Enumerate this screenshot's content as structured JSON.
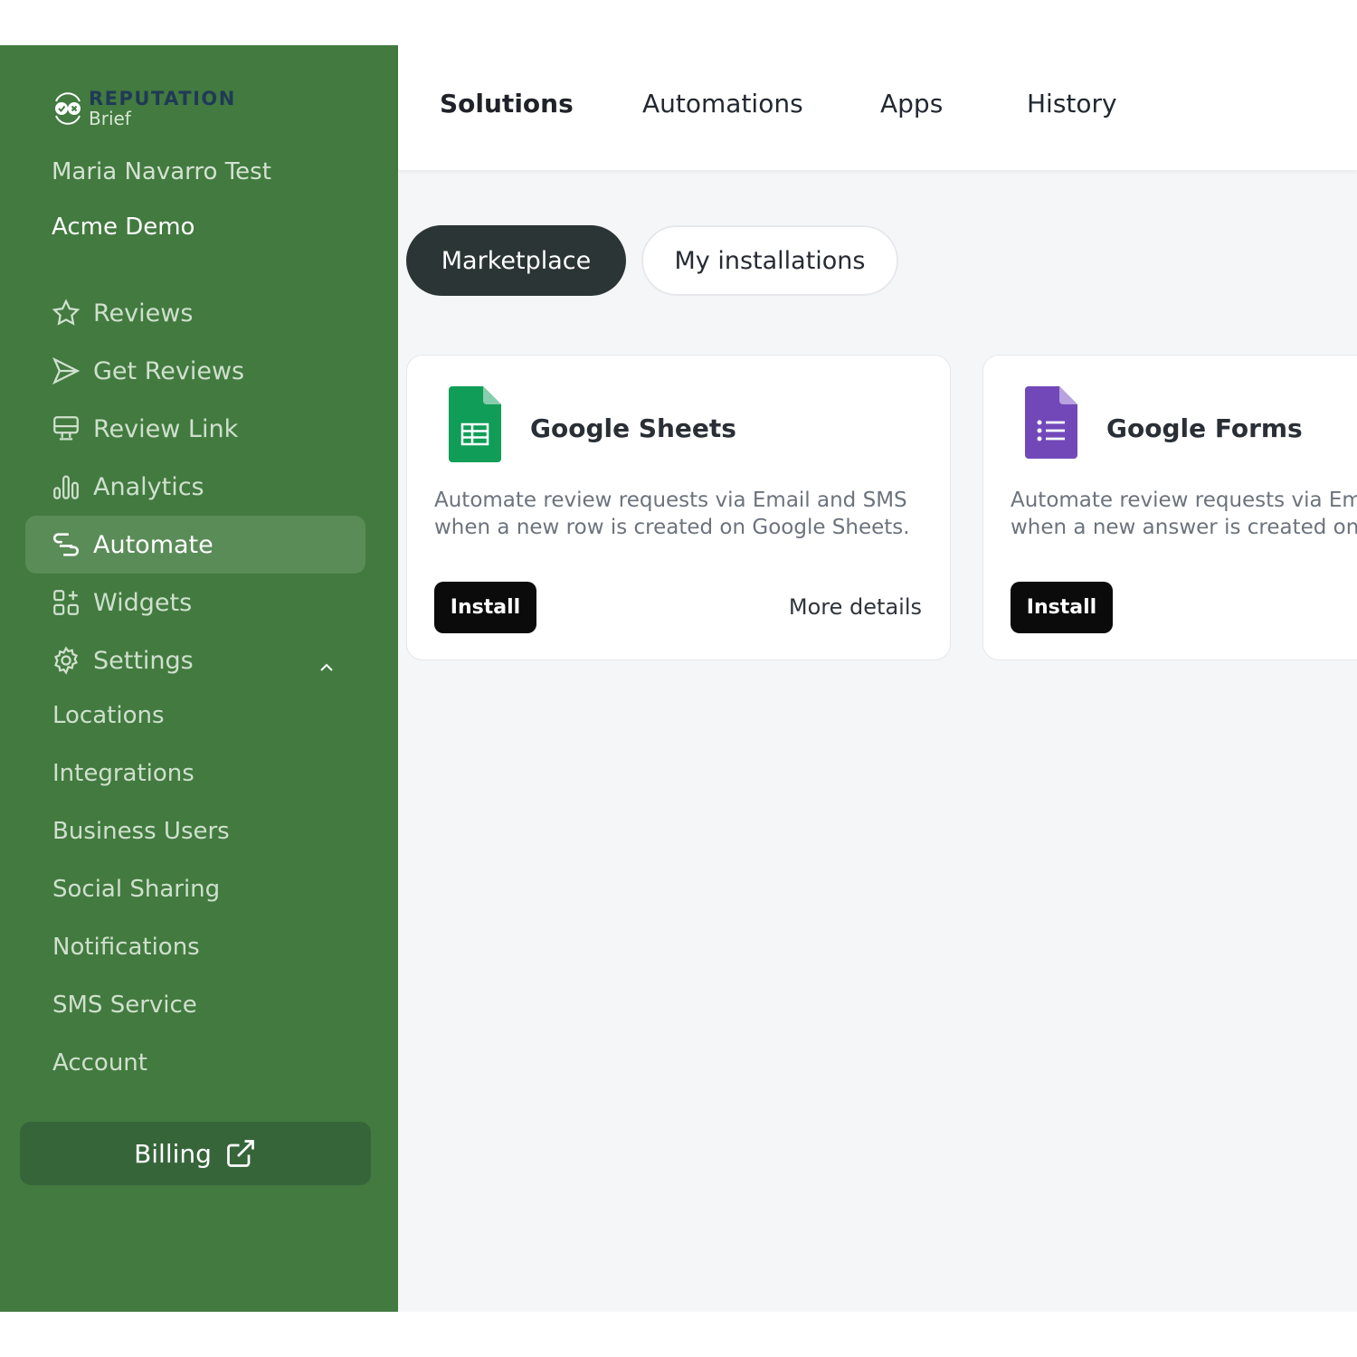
{
  "brand": {
    "name_top": "REPUTATION",
    "name_bottom": "Brief"
  },
  "account": {
    "user_name": "Maria Navarro Test",
    "business_name": "Acme Demo"
  },
  "sidebar": {
    "items": [
      {
        "label": "Reviews",
        "icon": "star-icon"
      },
      {
        "label": "Get Reviews",
        "icon": "send-icon"
      },
      {
        "label": "Review Link",
        "icon": "monitor-icon"
      },
      {
        "label": "Analytics",
        "icon": "bar-chart-icon"
      },
      {
        "label": "Automate",
        "icon": "link-icon",
        "active": true
      },
      {
        "label": "Widgets",
        "icon": "widgets-icon"
      },
      {
        "label": "Settings",
        "icon": "gear-icon",
        "expanded": true
      }
    ],
    "settings_sub": [
      "Locations",
      "Integrations",
      "Business Users",
      "Social Sharing",
      "Notifications",
      "SMS Service",
      "Account"
    ],
    "billing_label": "Billing"
  },
  "top_tabs": [
    {
      "label": "Solutions",
      "active": true
    },
    {
      "label": "Automations"
    },
    {
      "label": "Apps"
    },
    {
      "label": "History"
    }
  ],
  "pills": {
    "marketplace": "Marketplace",
    "my_installations": "My installations"
  },
  "cards": [
    {
      "title": "Google Sheets",
      "description": "Automate review requests via Email and SMS when a new row is created on Google Sheets.",
      "install_label": "Install",
      "more_label": "More details",
      "icon_color": "#0f9d58"
    },
    {
      "title": "Google Forms",
      "description": "Automate review requests via Email and SMS when a new answer is created on Google Form.",
      "install_label": "Install",
      "icon_color": "#7248b9"
    }
  ],
  "colors": {
    "sidebar": "#427a3f",
    "sidebar_active": "#5a8c57",
    "billing": "#36653a",
    "pill_active": "#2c3535"
  }
}
